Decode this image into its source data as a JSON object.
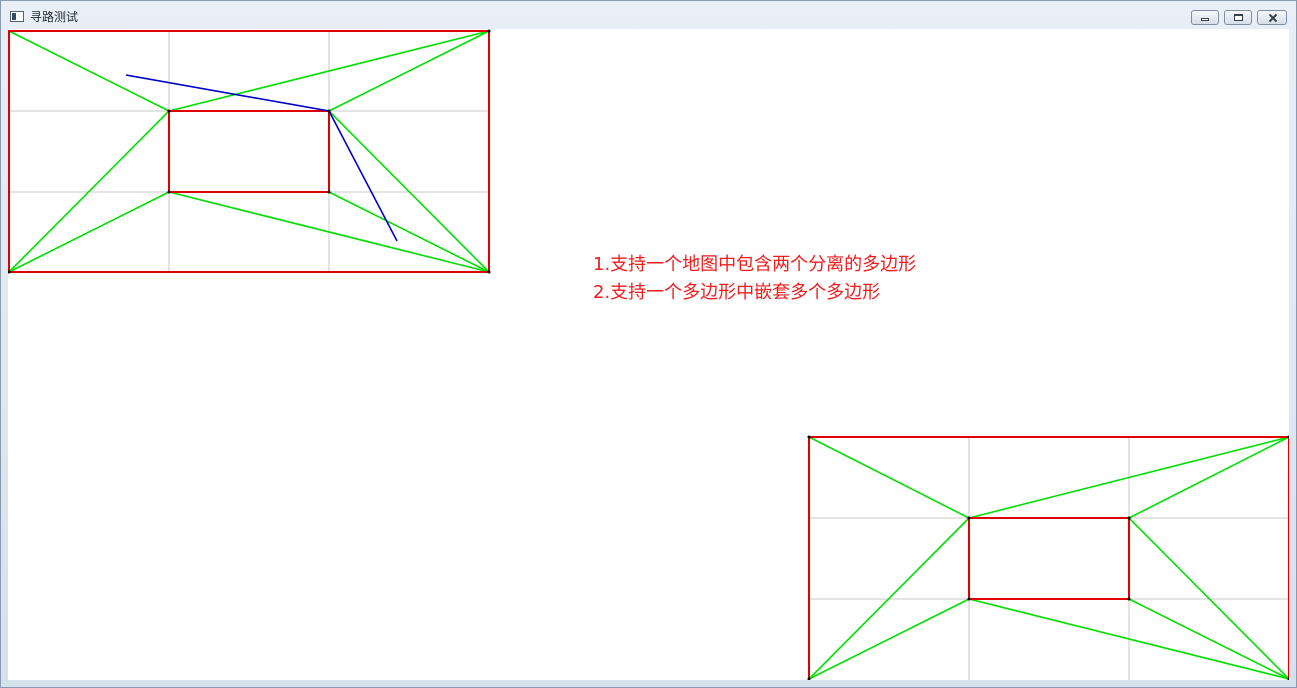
{
  "window": {
    "title": "寻路测试",
    "icon": "app-window-icon",
    "controls": {
      "minimize": "minimize-icon",
      "maximize": "maximize-icon",
      "close": "close-icon"
    }
  },
  "canvas": {
    "background": "#ffffff",
    "grid_color": "#c8c8c8",
    "polygon_color": "#e00000",
    "navmesh_color": "#00e000",
    "path_color": "#0000c8",
    "vertex_color": "#000000",
    "notes": [
      "1.支持一个地图中包含两个分离的多边形",
      "2.支持一个多边形中嵌套多个多边形"
    ],
    "note_color": "#ee1c1c"
  }
}
